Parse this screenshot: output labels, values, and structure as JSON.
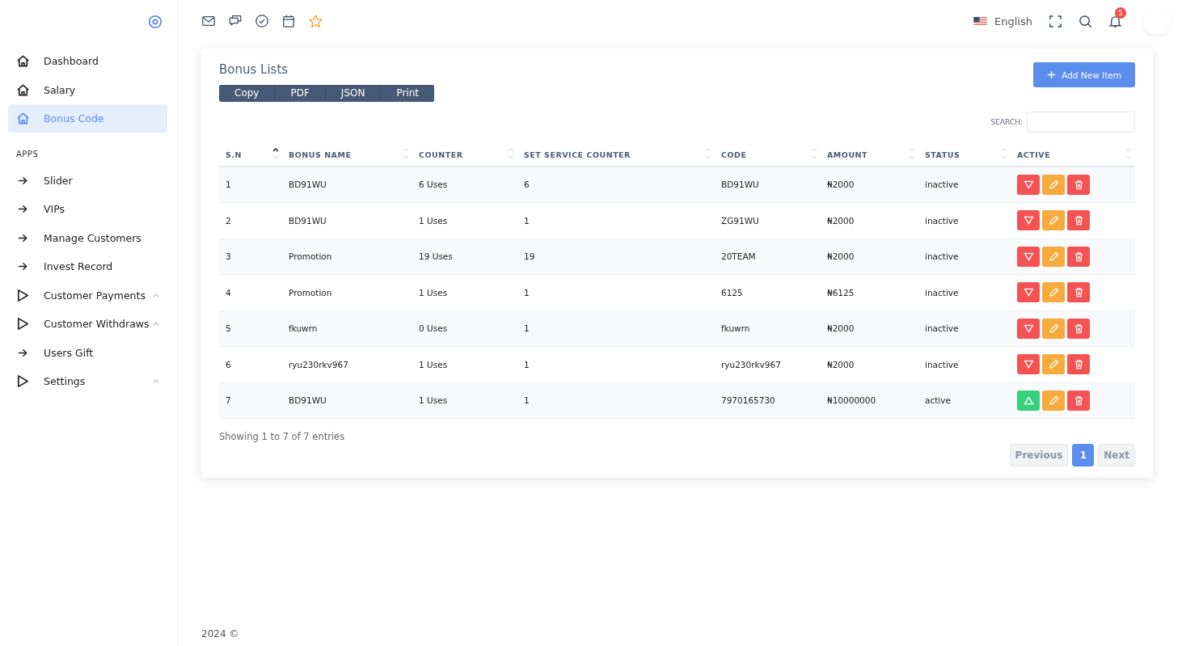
{
  "sidebar": {
    "items": [
      {
        "kind": "home",
        "label": "Dashboard",
        "selected": false
      },
      {
        "kind": "home",
        "label": "Salary",
        "selected": false
      },
      {
        "kind": "home",
        "label": "Bonus Code",
        "selected": true
      },
      {
        "kind": "heading",
        "label": "APPS"
      },
      {
        "kind": "arrow",
        "label": "Slider",
        "selected": false
      },
      {
        "kind": "arrow",
        "label": "VIPs",
        "selected": false
      },
      {
        "kind": "arrow",
        "label": "Manage Customers",
        "selected": false
      },
      {
        "kind": "arrow",
        "label": "Invest Record",
        "selected": false
      },
      {
        "kind": "group",
        "label": "Customer Payments",
        "selected": false,
        "expanded": false
      },
      {
        "kind": "group",
        "label": "Customer Withdraws",
        "selected": false,
        "expanded": false
      },
      {
        "kind": "arrow",
        "label": "Users Gift",
        "selected": false
      },
      {
        "kind": "group",
        "label": "Settings",
        "selected": false,
        "expanded": false
      }
    ]
  },
  "topbar": {
    "language": "English",
    "notification_count": "5"
  },
  "card": {
    "title": "Bonus Lists",
    "export_buttons": [
      "Copy",
      "PDF",
      "JSON",
      "Print"
    ],
    "add_button": "Add New Item",
    "search_label": "SEARCH:",
    "table": {
      "columns": [
        {
          "label": "S.N",
          "sorted": true
        },
        {
          "label": "BONUS NAME",
          "sorted": false
        },
        {
          "label": "COUNTER",
          "sorted": false
        },
        {
          "label": "SET SERVICE COUNTER",
          "sorted": false
        },
        {
          "label": "CODE",
          "sorted": false
        },
        {
          "label": "AMOUNT",
          "sorted": false
        },
        {
          "label": "STATUS",
          "sorted": false
        },
        {
          "label": "ACTIVE",
          "sorted": false
        }
      ],
      "rows": [
        {
          "sn": "1",
          "name": "BD91WU",
          "counter": "6 Uses",
          "service": "6",
          "code": "BD91WU",
          "amount": "₦2000",
          "status": "inactive",
          "active": false
        },
        {
          "sn": "2",
          "name": "BD91WU",
          "counter": "1 Uses",
          "service": "1",
          "code": "ZG91WU",
          "amount": "₦2000",
          "status": "inactive",
          "active": false
        },
        {
          "sn": "3",
          "name": "Promotion",
          "counter": "19 Uses",
          "service": "19",
          "code": "20TEAM",
          "amount": "₦2000",
          "status": "inactive",
          "active": false
        },
        {
          "sn": "4",
          "name": "Promotion",
          "counter": "1 Uses",
          "service": "1",
          "code": "6125",
          "amount": "₦6125",
          "status": "inactive",
          "active": false
        },
        {
          "sn": "5",
          "name": "fkuwrn",
          "counter": "0 Uses",
          "service": "1",
          "code": "fkuwrn",
          "amount": "₦2000",
          "status": "inactive",
          "active": false
        },
        {
          "sn": "6",
          "name": "ryu230rkv967",
          "counter": "1 Uses",
          "service": "1",
          "code": "ryu230rkv967",
          "amount": "₦2000",
          "status": "inactive",
          "active": false
        },
        {
          "sn": "7",
          "name": "BD91WU",
          "counter": "1 Uses",
          "service": "1",
          "code": "7970165730",
          "amount": "₦10000000",
          "status": "active",
          "active": true
        }
      ]
    },
    "info": "Showing 1 to 7 of 7 entries",
    "pagination": [
      {
        "label": "Previous",
        "kind": "nav",
        "disabled": true
      },
      {
        "label": "1",
        "kind": "page",
        "selected": true
      },
      {
        "label": "Next",
        "kind": "nav",
        "disabled": true
      }
    ]
  },
  "footer": "2024 ©"
}
